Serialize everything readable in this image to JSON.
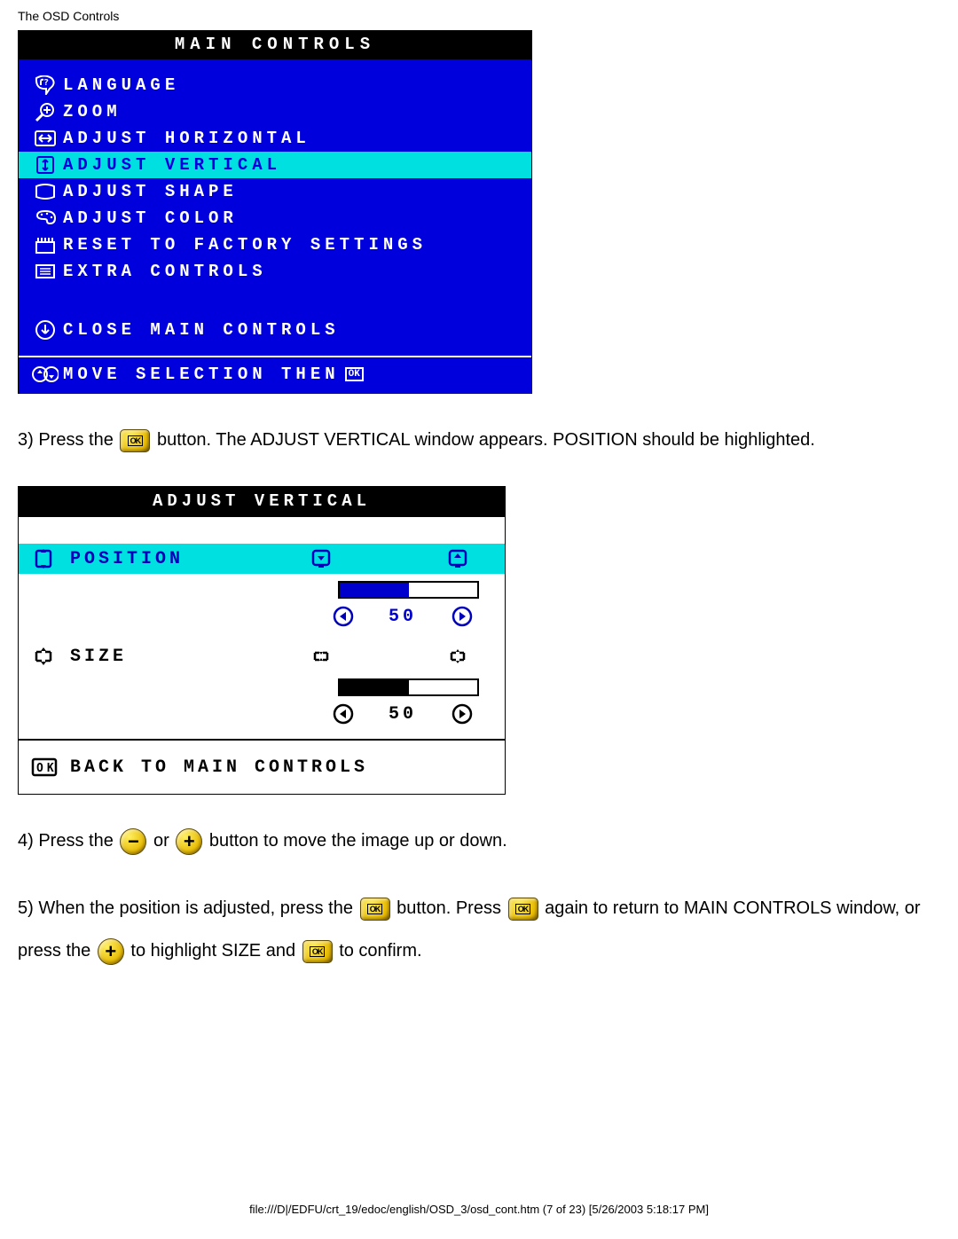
{
  "header": "The OSD Controls",
  "main_controls": {
    "title": "MAIN CONTROLS",
    "items": [
      {
        "icon": "language-icon",
        "label": "LANGUAGE",
        "highlighted": false
      },
      {
        "icon": "zoom-icon",
        "label": "ZOOM",
        "highlighted": false
      },
      {
        "icon": "adjust-horizontal-icon",
        "label": "ADJUST HORIZONTAL",
        "highlighted": false
      },
      {
        "icon": "adjust-vertical-icon",
        "label": "ADJUST VERTICAL",
        "highlighted": true
      },
      {
        "icon": "adjust-shape-icon",
        "label": "ADJUST SHAPE",
        "highlighted": false
      },
      {
        "icon": "adjust-color-icon",
        "label": "ADJUST COLOR",
        "highlighted": false
      },
      {
        "icon": "reset-icon",
        "label": "RESET TO FACTORY SETTINGS",
        "highlighted": false
      },
      {
        "icon": "extra-controls-icon",
        "label": "EXTRA CONTROLS",
        "highlighted": false
      }
    ],
    "close_label": "CLOSE MAIN CONTROLS",
    "footer_hint": "MOVE SELECTION THEN",
    "footer_ok": "OK"
  },
  "step3": {
    "a": "3) Press the ",
    "b": " button. The ADJUST VERTICAL window appears. POSITION should be highlighted."
  },
  "adjust_vertical": {
    "title": "ADJUST VERTICAL",
    "position_label": "POSITION",
    "position_value": "50",
    "position_fill_pct": 50,
    "size_label": "SIZE",
    "size_value": "50",
    "size_fill_pct": 50,
    "back_label": "BACK TO MAIN CONTROLS"
  },
  "step4": {
    "a": "4) Press the ",
    "b": " or ",
    "c": " button to move the image up or down."
  },
  "step5": {
    "a": "5) When the position is adjusted, press the ",
    "b": " button. Press ",
    "c": " again to return to MAIN CONTROLS window, or press the ",
    "d": " to highlight SIZE and ",
    "e": " to confirm."
  },
  "footer": "file:///D|/EDFU/crt_19/edoc/english/OSD_3/osd_cont.htm (7 of 23) [5/26/2003 5:18:17 PM]"
}
